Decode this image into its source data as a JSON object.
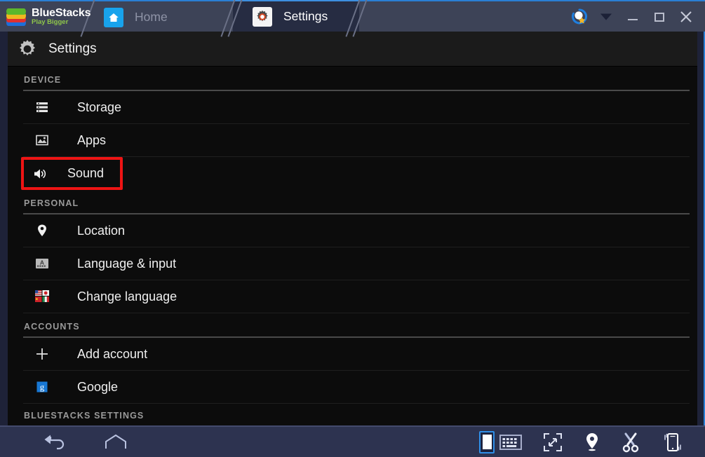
{
  "window": {
    "brand_name": "BlueStacks",
    "brand_tagline": "Play Bigger",
    "accent_blue": "#2a7fd4",
    "titlebar_bg": "#3d4357",
    "active_tab_bg": "#262c42",
    "highlight_color": "#ee1414"
  },
  "tabs": [
    {
      "id": "home",
      "label": "Home",
      "icon": "home-icon",
      "active": false
    },
    {
      "id": "settings",
      "label": "Settings",
      "icon": "gear-icon",
      "active": true
    }
  ],
  "window_controls": [
    {
      "id": "rate",
      "label": "Rate",
      "icon": "star-badge-icon"
    },
    {
      "id": "dropdown",
      "label": "More",
      "icon": "chevron-down-icon"
    },
    {
      "id": "minimize",
      "label": "Minimize",
      "icon": "minimize-icon"
    },
    {
      "id": "maximize",
      "label": "Maximize",
      "icon": "maximize-icon"
    },
    {
      "id": "close",
      "label": "Close",
      "icon": "close-icon"
    }
  ],
  "page": {
    "title": "Settings",
    "icon": "gear-icon"
  },
  "sections": [
    {
      "heading": "DEVICE",
      "items": [
        {
          "label": "Storage",
          "icon": "storage-icon",
          "highlighted": false
        },
        {
          "label": "Apps",
          "icon": "apps-icon",
          "highlighted": false
        },
        {
          "label": "Sound",
          "icon": "volume-icon",
          "highlighted": true
        }
      ]
    },
    {
      "heading": "PERSONAL",
      "items": [
        {
          "label": "Location",
          "icon": "location-pin-icon",
          "highlighted": false
        },
        {
          "label": "Language & input",
          "icon": "keyboard-a-icon",
          "highlighted": false
        },
        {
          "label": "Change language",
          "icon": "flags-icon",
          "highlighted": false
        }
      ]
    },
    {
      "heading": "ACCOUNTS",
      "items": [
        {
          "label": "Add account",
          "icon": "plus-icon",
          "highlighted": false
        },
        {
          "label": "Google",
          "icon": "google-icon",
          "highlighted": false
        }
      ]
    },
    {
      "heading": "BLUESTACKS SETTINGS",
      "clipped": true,
      "items": []
    }
  ],
  "bottombar": {
    "left": [
      {
        "id": "back",
        "label": "Back",
        "icon": "back-arrow-icon"
      },
      {
        "id": "home",
        "label": "Home",
        "icon": "home-outline-icon"
      }
    ],
    "right": [
      {
        "id": "portrait",
        "label": "Portrait mode",
        "icon": "portrait-phone-icon",
        "active": true
      },
      {
        "id": "keyboard",
        "label": "Keyboard",
        "icon": "keyboard-icon"
      },
      {
        "id": "fullscreen",
        "label": "Fullscreen",
        "icon": "fullscreen-icon"
      },
      {
        "id": "location",
        "label": "Location",
        "icon": "location-pin-icon"
      },
      {
        "id": "screenshot",
        "label": "Screenshot",
        "icon": "scissors-icon"
      },
      {
        "id": "shake",
        "label": "Shake",
        "icon": "shake-phone-icon"
      }
    ]
  }
}
